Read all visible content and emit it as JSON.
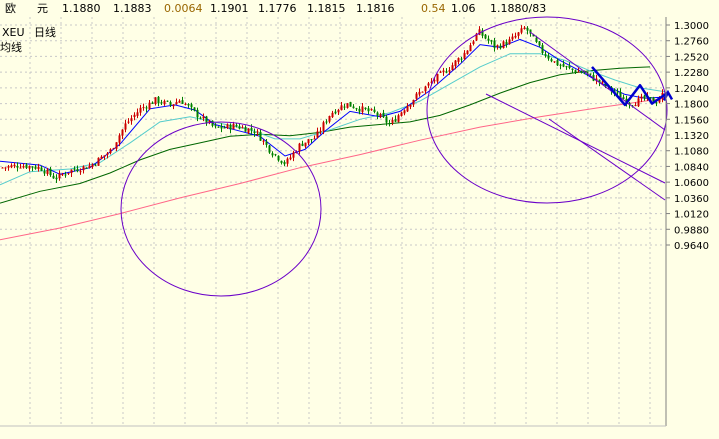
{
  "quote_bar": {
    "label_a": "欧",
    "label_b": "元",
    "open": "1.1880",
    "high": "1.1883",
    "change": "0.0064",
    "v1": "1.1901",
    "v2": "1.1776",
    "v3": "1.1815",
    "v4": "1.1816",
    "pct": "0.54",
    "v5": "1.06",
    "v6": "1.1880/83"
  },
  "chart_title": {
    "symbol": "XEU",
    "period": "日线",
    "indicator": "均线"
  },
  "colors": {
    "background": "#ffffe6",
    "bull_candle": "#cc0000",
    "bear_candle": "#008000",
    "ma_short": "#0000ff",
    "ma_mid": "#55cccc",
    "ma_long": "#006600",
    "ma_very_long": "#ff6688",
    "annotation": "#6a00c8",
    "zigzag": "#0000cc",
    "highlight_change": "#996600"
  },
  "chart_data": {
    "type": "candlestick",
    "y_axis_side": "right",
    "ylim": [
      0.946,
      1.305
    ],
    "yticks": [
      "1.3000",
      "1.2760",
      "1.2520",
      "1.2280",
      "1.2040",
      "1.1800",
      "1.1560",
      "1.1320",
      "1.1080",
      "1.0840",
      "1.0600",
      "1.0360",
      "1.0120",
      "0.9880",
      "0.9640"
    ],
    "close_path": [
      [
        0,
        1.082
      ],
      [
        20,
        1.086
      ],
      [
        40,
        1.082
      ],
      [
        55,
        1.066
      ],
      [
        70,
        1.078
      ],
      [
        90,
        1.085
      ],
      [
        110,
        1.108
      ],
      [
        125,
        1.148
      ],
      [
        140,
        1.172
      ],
      [
        155,
        1.185
      ],
      [
        170,
        1.178
      ],
      [
        180,
        1.186
      ],
      [
        195,
        1.165
      ],
      [
        215,
        1.142
      ],
      [
        235,
        1.146
      ],
      [
        255,
        1.138
      ],
      [
        270,
        1.108
      ],
      [
        285,
        1.088
      ],
      [
        300,
        1.118
      ],
      [
        315,
        1.128
      ],
      [
        330,
        1.165
      ],
      [
        345,
        1.18
      ],
      [
        360,
        1.172
      ],
      [
        375,
        1.165
      ],
      [
        390,
        1.148
      ],
      [
        405,
        1.175
      ],
      [
        420,
        1.198
      ],
      [
        435,
        1.218
      ],
      [
        450,
        1.236
      ],
      [
        465,
        1.258
      ],
      [
        478,
        1.29
      ],
      [
        495,
        1.266
      ],
      [
        510,
        1.276
      ],
      [
        525,
        1.296
      ],
      [
        540,
        1.262
      ],
      [
        555,
        1.242
      ],
      [
        570,
        1.232
      ],
      [
        585,
        1.226
      ],
      [
        600,
        1.212
      ],
      [
        615,
        1.196
      ],
      [
        630,
        1.18
      ],
      [
        645,
        1.188
      ],
      [
        655,
        1.182
      ],
      [
        665,
        1.198
      ]
    ],
    "ma_short": [
      [
        0,
        1.092
      ],
      [
        40,
        1.086
      ],
      [
        60,
        1.072
      ],
      [
        90,
        1.082
      ],
      [
        120,
        1.118
      ],
      [
        150,
        1.172
      ],
      [
        175,
        1.178
      ],
      [
        195,
        1.17
      ],
      [
        215,
        1.148
      ],
      [
        235,
        1.14
      ],
      [
        260,
        1.13
      ],
      [
        285,
        1.1
      ],
      [
        305,
        1.11
      ],
      [
        325,
        1.138
      ],
      [
        350,
        1.168
      ],
      [
        380,
        1.16
      ],
      [
        400,
        1.168
      ],
      [
        430,
        1.2
      ],
      [
        460,
        1.24
      ],
      [
        480,
        1.27
      ],
      [
        500,
        1.266
      ],
      [
        520,
        1.278
      ],
      [
        540,
        1.266
      ],
      [
        560,
        1.246
      ],
      [
        580,
        1.23
      ],
      [
        600,
        1.212
      ],
      [
        625,
        1.194
      ],
      [
        645,
        1.188
      ],
      [
        665,
        1.19
      ]
    ],
    "ma_mid": [
      [
        0,
        1.056
      ],
      [
        30,
        1.076
      ],
      [
        70,
        1.08
      ],
      [
        100,
        1.09
      ],
      [
        130,
        1.12
      ],
      [
        160,
        1.152
      ],
      [
        190,
        1.16
      ],
      [
        220,
        1.15
      ],
      [
        250,
        1.14
      ],
      [
        275,
        1.126
      ],
      [
        300,
        1.126
      ],
      [
        330,
        1.14
      ],
      [
        360,
        1.156
      ],
      [
        390,
        1.166
      ],
      [
        420,
        1.184
      ],
      [
        450,
        1.21
      ],
      [
        480,
        1.236
      ],
      [
        510,
        1.256
      ],
      [
        540,
        1.256
      ],
      [
        565,
        1.246
      ],
      [
        590,
        1.23
      ],
      [
        615,
        1.216
      ],
      [
        640,
        1.204
      ],
      [
        665,
        1.198
      ]
    ],
    "ma_long": [
      [
        0,
        1.028
      ],
      [
        40,
        1.046
      ],
      [
        80,
        1.058
      ],
      [
        110,
        1.074
      ],
      [
        140,
        1.094
      ],
      [
        170,
        1.11
      ],
      [
        200,
        1.12
      ],
      [
        230,
        1.13
      ],
      [
        260,
        1.133
      ],
      [
        290,
        1.131
      ],
      [
        320,
        1.136
      ],
      [
        350,
        1.144
      ],
      [
        380,
        1.148
      ],
      [
        410,
        1.152
      ],
      [
        440,
        1.162
      ],
      [
        470,
        1.178
      ],
      [
        500,
        1.196
      ],
      [
        530,
        1.212
      ],
      [
        560,
        1.224
      ],
      [
        590,
        1.23
      ],
      [
        620,
        1.234
      ],
      [
        650,
        1.236
      ]
    ],
    "ma_very_long": [
      [
        0,
        0.972
      ],
      [
        60,
        0.99
      ],
      [
        120,
        1.012
      ],
      [
        180,
        1.036
      ],
      [
        240,
        1.058
      ],
      [
        300,
        1.082
      ],
      [
        360,
        1.102
      ],
      [
        420,
        1.124
      ],
      [
        480,
        1.144
      ],
      [
        540,
        1.16
      ],
      [
        600,
        1.174
      ],
      [
        665,
        1.188
      ]
    ],
    "zigzag": [
      [
        592,
        1.236
      ],
      [
        625,
        1.178
      ],
      [
        640,
        1.208
      ],
      [
        652,
        1.18
      ],
      [
        668,
        1.197
      ]
    ]
  }
}
